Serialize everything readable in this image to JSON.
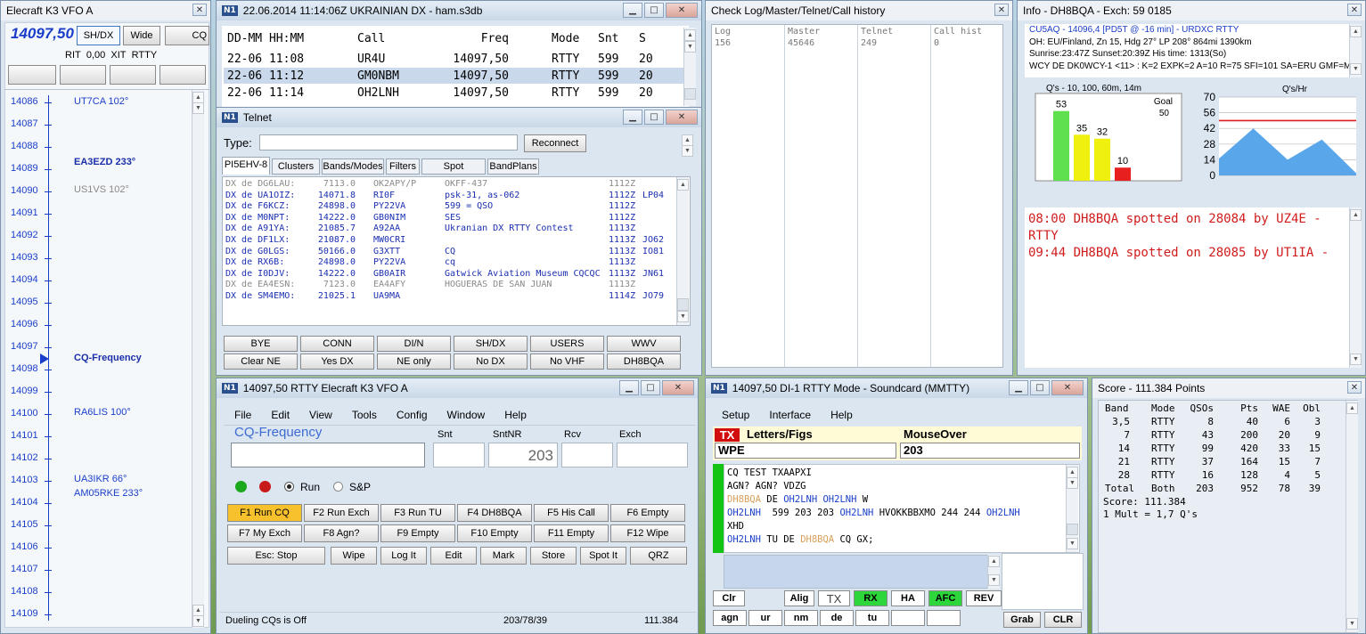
{
  "vfo_win": {
    "title": "Elecraft K3 VFO A",
    "freq": "14097,50",
    "btn_shdx": "SH/DX",
    "btn_wide": "Wide",
    "btn_cq": "CQ",
    "rit": "RIT",
    "rit_val": "0,00",
    "xit": "XIT",
    "rtty": "RTTY",
    "scale": [
      "14086",
      "14087",
      "14088",
      "14089",
      "14090",
      "14091",
      "14092",
      "14093",
      "14094",
      "14095",
      "14096",
      "14097",
      "14098",
      "14099",
      "14100",
      "14101",
      "14102",
      "14103",
      "14104",
      "14105",
      "14106",
      "14107",
      "14108",
      "14109"
    ],
    "spots": [
      {
        "call": "UT7CA 102°",
        "row": 0,
        "style": "blue"
      },
      {
        "call": "EA3EZD 233°",
        "row": 2.7,
        "style": "bold"
      },
      {
        "call": "US1VS 102°",
        "row": 3.95,
        "style": "gray"
      },
      {
        "call": "CQ-Frequency",
        "row": 11.5,
        "style": "bold"
      },
      {
        "call": "RA6LIS 100°",
        "row": 13.95,
        "style": "blue"
      },
      {
        "call": "UA3IKR 66°",
        "row": 16.95,
        "style": "blue"
      },
      {
        "call": "AM05RKE 233°",
        "row": 17.6,
        "style": "blue"
      }
    ]
  },
  "log_win": {
    "title": "22.06.2014 11:14:06Z  UKRAINIAN DX - ham.s3db",
    "headers": [
      "DD-MM HH:MM",
      "Call",
      "Freq",
      "Mode",
      "Snt",
      "S"
    ],
    "rows": [
      [
        "22-06 11:08",
        "UR4U",
        "14097,50",
        "RTTY",
        "599",
        "20"
      ],
      [
        "22-06 11:12",
        "GM0NBM",
        "14097,50",
        "RTTY",
        "599",
        "20"
      ],
      [
        "22-06 11:14",
        "OH2LNH",
        "14097,50",
        "RTTY",
        "599",
        "20"
      ]
    ]
  },
  "check_win": {
    "title": "Check Log/Master/Telnet/Call history",
    "cols": [
      {
        "h": "Log",
        "v": "156"
      },
      {
        "h": "Master",
        "v": "45646"
      },
      {
        "h": "Telnet",
        "v": "249"
      },
      {
        "h": "Call hist",
        "v": "0"
      }
    ]
  },
  "info_win": {
    "title": "Info - DH8BQA - Exch: 59 0185",
    "lines": [
      "CU5AQ - 14096,4 [PD5T @ -16 min] - URDXC RTTY",
      "OH: EU/Finland, Zn 15, Hdg 27° LP 208° 864mi 1390km",
      "Sunrise:23:47Z Sunset:20:39Z His time: 1313(So)",
      "WCY DE DK0WCY-1 <11> : K=2 EXPK=2 A=10 R=75 SFI=101 SA=ERU GMF=M"
    ],
    "bar_title": "Q's - 10, 100, 60m, 14m",
    "goal_label": "Goal",
    "goal_value": "50",
    "rate_title": "Q's/Hr",
    "rate_ticks": [
      "70",
      "56",
      "42",
      "28",
      "14",
      "0"
    ],
    "spotted": [
      "08:00 DH8BQA spotted on 28084 by UZ4E - RTTY",
      "09:44 DH8BQA spotted on 28085 by UT1IA -"
    ],
    "colors": {
      "bar1": "#5fe04f",
      "bar2": "#f0f00e",
      "bar3": "#f0f00e",
      "bar4": "#e81f1f",
      "rate": "#5aa6ea",
      "goal": "#e01e1e"
    }
  },
  "chart_data": [
    {
      "type": "bar",
      "title": "Q's - 10, 100, 60m, 14m",
      "categories": [
        "10",
        "100",
        "60m",
        "14m"
      ],
      "values": [
        53,
        35,
        32,
        10
      ],
      "goal": 50
    },
    {
      "type": "area",
      "title": "Q's/Hr",
      "x": [
        0,
        1,
        2,
        3,
        4
      ],
      "values": [
        15,
        42,
        14,
        32,
        2
      ],
      "ylim": [
        0,
        70
      ],
      "ref_line": 49
    }
  ],
  "telnet_win": {
    "title": "Telnet",
    "type_label": "Type:",
    "reconnect": "Reconnect",
    "tabs": [
      "PI5EHV-8",
      "Clusters",
      "Bands/Modes",
      "Filters",
      "Spot Comment",
      "BandPlans"
    ],
    "spots": [
      {
        "de": "DX de DG6LAU:",
        "f": "7113.0",
        "call": "OK2APY/P",
        "c": "OKFF-437",
        "t": "1112Z",
        "x": "",
        "gray": true
      },
      {
        "de": "DX de UA1OIZ:",
        "f": "14071.8",
        "call": "RI0F",
        "c": "psk-31, as-062",
        "t": "1112Z",
        "x": "LP04",
        "gray": false
      },
      {
        "de": "DX de F6KCZ:",
        "f": "24898.0",
        "call": "PY22VA",
        "c": "599 = QSO",
        "t": "1112Z",
        "x": "",
        "gray": false
      },
      {
        "de": "DX de M0NPT:",
        "f": "14222.0",
        "call": "GB0NIM",
        "c": "SES",
        "t": "1112Z",
        "x": "",
        "gray": false
      },
      {
        "de": "DX de A91YA:",
        "f": "21085.7",
        "call": "A92AA",
        "c": "Ukranian DX RTTY Contest",
        "t": "1113Z",
        "x": "",
        "gray": false
      },
      {
        "de": "DX de DF1LX:",
        "f": "21087.0",
        "call": "MW0CRI",
        "c": "",
        "t": "1113Z",
        "x": "JO62",
        "gray": false
      },
      {
        "de": "DX de G0LGS:",
        "f": "50166.0",
        "call": "G3XTT",
        "c": "CQ",
        "t": "1113Z",
        "x": "IO81",
        "gray": false
      },
      {
        "de": "DX de RX6B:",
        "f": "24898.0",
        "call": "PY22VA",
        "c": "cq",
        "t": "1113Z",
        "x": "",
        "gray": false
      },
      {
        "de": "DX de I0DJV:",
        "f": "14222.0",
        "call": "GB0AIR",
        "c": "Gatwick Aviation Museum  CQCQC",
        "t": "1113Z",
        "x": "JN61",
        "gray": false
      },
      {
        "de": "DX de EA4ESN:",
        "f": "7123.0",
        "call": "EA4AFY",
        "c": "HOGUERAS DE SAN JUAN",
        "t": "1113Z",
        "x": "",
        "gray": true
      },
      {
        "de": "DX de SM4EMO:",
        "f": "21025.1",
        "call": "UA9MA",
        "c": "",
        "t": "1114Z",
        "x": "JO79",
        "gray": false
      }
    ],
    "buttons": [
      "BYE",
      "CONN",
      "DI/N",
      "SH/DX",
      "USERS",
      "WWV",
      "Clear NE",
      "Yes DX",
      "NE only",
      "No DX",
      "No VHF",
      "DH8BQA"
    ]
  },
  "entry_win": {
    "title": "14097,50 RTTY Elecraft K3 VFO A",
    "menu": [
      "File",
      "Edit",
      "View",
      "Tools",
      "Config",
      "Window",
      "Help"
    ],
    "cq": "CQ-Frequency",
    "snt": "Snt",
    "sntnr": "SntNR",
    "rcv": "Rcv",
    "exch": "Exch",
    "sntnr_val": "203",
    "run": "Run",
    "sp": "S&P",
    "fkeys": [
      "F1 Run CQ",
      "F2 Run Exch",
      "F3 Run TU",
      "F4 DH8BQA",
      "F5 His Call",
      "F6 Empty",
      "F7 My Exch",
      "F8 Agn?",
      "F9 Empty",
      "F10 Empty",
      "F11 Empty",
      "F12 Wipe"
    ],
    "bottom_btns": [
      "Esc: Stop",
      "Wipe",
      "Log It",
      "Edit",
      "Mark",
      "Store",
      "Spot It",
      "QRZ"
    ],
    "status": "Dueling CQs is Off",
    "status_mid": "203/78/39",
    "status_right": "111.384",
    "colors": {
      "f1": "#f7c12d"
    }
  },
  "mmtty_win": {
    "title": "14097,50  DI-1 RTTY Mode - Soundcard (MMTTY)",
    "menu": [
      "Setup",
      "Interface",
      "Help"
    ],
    "tx": "TX",
    "letters": "Letters/Figs",
    "mouseover": "MouseOver",
    "field1": "WPE",
    "field2": "203",
    "rx_lines": [
      [
        {
          "t": "CQ TEST TXAAPXI",
          "c": "k"
        }
      ],
      [
        {
          "t": "AGN? AGN? VDZG",
          "c": "k"
        }
      ],
      [
        {
          "t": "DH8BQA",
          "c": "o"
        },
        {
          "t": " DE ",
          "c": "k"
        },
        {
          "t": "OH2LNH OH2LNH",
          "c": "b"
        },
        {
          "t": " W",
          "c": "k"
        }
      ],
      [
        {
          "t": "OH2LNH",
          "c": "b"
        },
        {
          "t": "  599 203 203 ",
          "c": "k"
        },
        {
          "t": "OH2LNH",
          "c": "b"
        },
        {
          "t": " HVOKKBBXMO 244 244 ",
          "c": "k"
        },
        {
          "t": "OH2LNH",
          "c": "b"
        }
      ],
      [
        {
          "t": "XHD",
          "c": "k"
        }
      ],
      [
        {
          "t": "OH2LNH",
          "c": "b"
        },
        {
          "t": " TU DE ",
          "c": "k"
        },
        {
          "t": "DH8BQA",
          "c": "o"
        },
        {
          "t": " CQ GX;",
          "c": "k"
        }
      ]
    ],
    "ctrl": [
      "Clr",
      "Alig",
      "TX",
      "RX",
      "HA",
      "AFC",
      "REV"
    ],
    "macros": [
      "agn",
      "ur",
      "nm",
      "de",
      "tu",
      "",
      ""
    ],
    "grab": "Grab",
    "clr": "CLR"
  },
  "score_win": {
    "title": "Score - 111.384 Points",
    "headers": [
      "Band",
      "Mode",
      "QSOs",
      "Pts",
      "WAE",
      "Obl"
    ],
    "rows": [
      [
        "3,5",
        "RTTY",
        "8",
        "40",
        "6",
        "3"
      ],
      [
        "7",
        "RTTY",
        "43",
        "200",
        "20",
        "9"
      ],
      [
        "14",
        "RTTY",
        "99",
        "420",
        "33",
        "15"
      ],
      [
        "21",
        "RTTY",
        "37",
        "164",
        "15",
        "7"
      ],
      [
        "28",
        "RTTY",
        "16",
        "128",
        "4",
        "5"
      ],
      [
        "Total",
        "Both",
        "203",
        "952",
        "78",
        "39"
      ]
    ],
    "score_line": "Score: 111.384",
    "mult_line": "1 Mult = 1,7 Q's"
  }
}
